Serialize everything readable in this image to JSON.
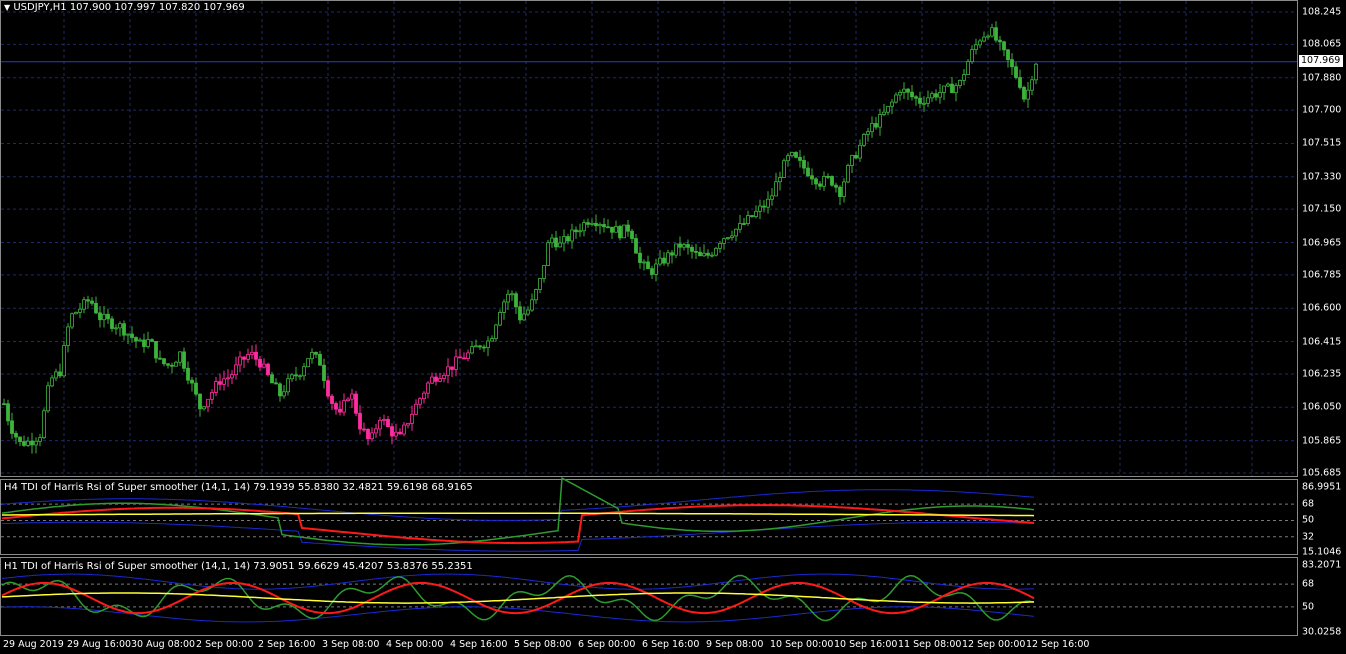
{
  "symbol_header": {
    "caret": "▼",
    "text": "USDJPY,H1  107.900 107.997 107.820 107.969"
  },
  "current_price": "107.969",
  "price_axis": [
    "108.245",
    "108.065",
    "107.880",
    "107.700",
    "107.515",
    "107.330",
    "107.150",
    "106.965",
    "106.785",
    "106.600",
    "106.415",
    "106.235",
    "106.050",
    "105.865",
    "105.685"
  ],
  "time_axis": [
    "29 Aug 2019",
    "29 Aug 16:00",
    "30 Aug 08:00",
    "2 Sep 00:00",
    "2 Sep 16:00",
    "3 Sep 08:00",
    "4 Sep 00:00",
    "4 Sep 16:00",
    "5 Sep 08:00",
    "6 Sep 00:00",
    "6 Sep 16:00",
    "9 Sep 08:00",
    "10 Sep 00:00",
    "10 Sep 16:00",
    "11 Sep 08:00",
    "12 Sep 00:00",
    "12 Sep 16:00"
  ],
  "indicator_h4": {
    "title": "H4 TDI of Harris Rsi of Super smoother (14,1, 14) 79.1939 55.8380 32.4821 59.6198 68.9165",
    "axis": [
      "86.9951",
      "68",
      "50",
      "32",
      "15.1046"
    ]
  },
  "indicator_h1": {
    "title": "H1 TDI of Harris Rsi of Super smoother (14,1, 14) 73.9051 59.6629 45.4207 53.8376 55.2351",
    "axis": [
      "83.2071",
      "68",
      "50",
      "30.0258"
    ]
  },
  "colors": {
    "background": "#000000",
    "grid": "#1c2a6e",
    "bull_candle": "#3cb43c",
    "bear_candle_highlight": "#ff2da0",
    "band": "#1a2ad0",
    "signal_red": "#ff1a1a",
    "base_yellow": "#ffff33",
    "rsi_green": "#2e9b2e",
    "level": "#7a7a7a"
  },
  "chart_data": {
    "type": "candlestick",
    "title": "USDJPY,H1",
    "ylim": [
      105.685,
      108.245
    ],
    "path": [
      [
        0,
        106.15
      ],
      [
        10,
        105.95
      ],
      [
        20,
        105.85
      ],
      [
        30,
        105.86
      ],
      [
        40,
        105.9
      ],
      [
        50,
        106.2
      ],
      [
        60,
        106.25
      ],
      [
        70,
        106.55
      ],
      [
        80,
        106.6
      ],
      [
        90,
        106.65
      ],
      [
        100,
        106.55
      ],
      [
        110,
        106.52
      ],
      [
        120,
        106.5
      ],
      [
        130,
        106.45
      ],
      [
        140,
        106.4
      ],
      [
        150,
        106.42
      ],
      [
        160,
        106.3
      ],
      [
        170,
        106.28
      ],
      [
        180,
        106.35
      ],
      [
        190,
        106.2
      ],
      [
        200,
        106.05
      ],
      [
        210,
        106.12
      ],
      [
        220,
        106.2
      ],
      [
        230,
        106.22
      ],
      [
        240,
        106.3
      ],
      [
        250,
        106.35
      ],
      [
        260,
        106.3
      ],
      [
        270,
        106.2
      ],
      [
        280,
        106.12
      ],
      [
        290,
        106.2
      ],
      [
        300,
        106.25
      ],
      [
        310,
        106.35
      ],
      [
        320,
        106.3
      ],
      [
        330,
        106.1
      ],
      [
        340,
        106.0
      ],
      [
        350,
        106.15
      ],
      [
        360,
        105.95
      ],
      [
        370,
        105.85
      ],
      [
        380,
        106.0
      ],
      [
        390,
        105.92
      ],
      [
        400,
        105.88
      ],
      [
        410,
        106.0
      ],
      [
        420,
        106.1
      ],
      [
        430,
        106.2
      ],
      [
        440,
        106.24
      ],
      [
        450,
        106.27
      ],
      [
        460,
        106.32
      ],
      [
        470,
        106.35
      ],
      [
        480,
        106.4
      ],
      [
        490,
        106.42
      ],
      [
        500,
        106.6
      ],
      [
        510,
        106.7
      ],
      [
        520,
        106.55
      ],
      [
        530,
        106.6
      ],
      [
        540,
        106.75
      ],
      [
        550,
        107.0
      ],
      [
        560,
        106.95
      ],
      [
        570,
        107.0
      ],
      [
        580,
        107.05
      ],
      [
        590,
        107.1
      ],
      [
        600,
        107.08
      ],
      [
        610,
        107.05
      ],
      [
        620,
        107.02
      ],
      [
        630,
        107.05
      ],
      [
        640,
        106.85
      ],
      [
        650,
        106.8
      ],
      [
        660,
        106.85
      ],
      [
        670,
        106.9
      ],
      [
        680,
        106.95
      ],
      [
        690,
        106.92
      ],
      [
        700,
        106.88
      ],
      [
        710,
        106.9
      ],
      [
        720,
        106.98
      ],
      [
        730,
        107.02
      ],
      [
        740,
        107.05
      ],
      [
        750,
        107.1
      ],
      [
        760,
        107.15
      ],
      [
        770,
        107.2
      ],
      [
        780,
        107.35
      ],
      [
        790,
        107.45
      ],
      [
        800,
        107.4
      ],
      [
        810,
        107.35
      ],
      [
        820,
        107.3
      ],
      [
        830,
        107.32
      ],
      [
        840,
        107.25
      ],
      [
        850,
        107.4
      ],
      [
        860,
        107.5
      ],
      [
        870,
        107.6
      ],
      [
        880,
        107.65
      ],
      [
        890,
        107.72
      ],
      [
        900,
        107.82
      ],
      [
        910,
        107.78
      ],
      [
        920,
        107.75
      ],
      [
        930,
        107.78
      ],
      [
        940,
        107.8
      ],
      [
        950,
        107.82
      ],
      [
        960,
        107.85
      ],
      [
        970,
        108.0
      ],
      [
        980,
        108.1
      ],
      [
        990,
        108.15
      ],
      [
        1000,
        108.05
      ],
      [
        1010,
        107.95
      ],
      [
        1020,
        107.85
      ],
      [
        1025,
        107.75
      ],
      [
        1030,
        107.85
      ],
      [
        1035,
        107.97
      ]
    ]
  }
}
